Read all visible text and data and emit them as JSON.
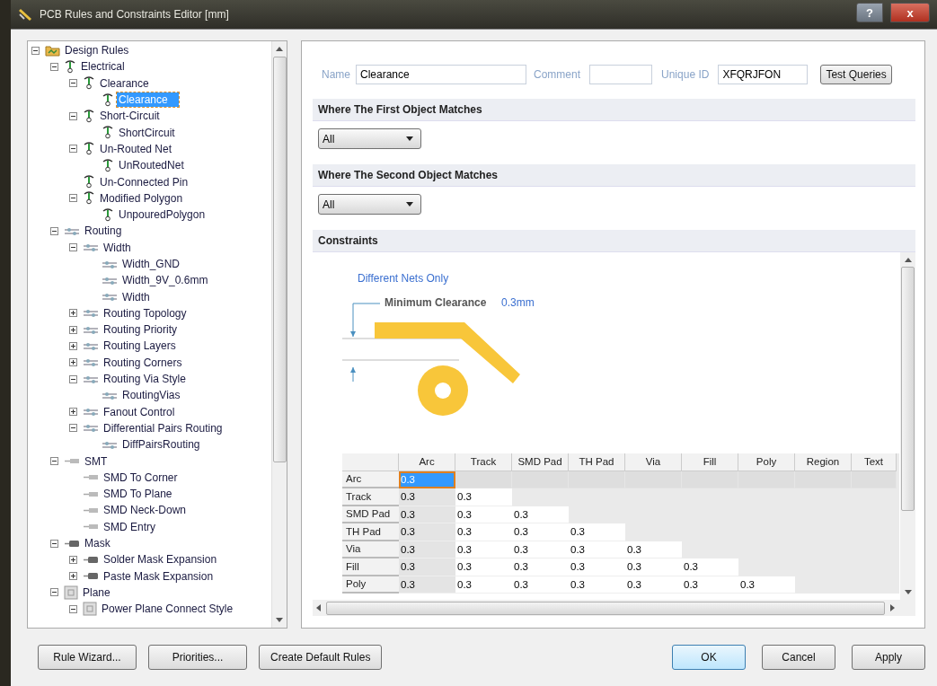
{
  "window": {
    "title": "PCB Rules and Constraints Editor [mm]",
    "help_button": "?",
    "close_button": "x"
  },
  "tree": [
    {
      "label": "Design Rules",
      "kind": "folder",
      "expanded": true,
      "selected": false,
      "children": [
        {
          "label": "Electrical",
          "kind": "electrical",
          "expanded": true,
          "selected": false,
          "children": [
            {
              "label": "Clearance",
              "kind": "electrical",
              "expanded": true,
              "selected": false,
              "children": [
                {
                  "label": "Clearance",
                  "kind": "electrical",
                  "selected": true
                }
              ]
            },
            {
              "label": "Short-Circuit",
              "kind": "electrical",
              "expanded": true,
              "selected": false,
              "children": [
                {
                  "label": "ShortCircuit",
                  "kind": "electrical",
                  "selected": false
                }
              ]
            },
            {
              "label": "Un-Routed Net",
              "kind": "electrical",
              "expanded": true,
              "selected": false,
              "children": [
                {
                  "label": "UnRoutedNet",
                  "kind": "electrical",
                  "selected": false
                }
              ]
            },
            {
              "label": "Un-Connected Pin",
              "kind": "electrical",
              "selected": false
            },
            {
              "label": "Modified Polygon",
              "kind": "electrical",
              "expanded": true,
              "selected": false,
              "children": [
                {
                  "label": "UnpouredPolygon",
                  "kind": "electrical",
                  "selected": false
                }
              ]
            }
          ]
        },
        {
          "label": "Routing",
          "kind": "routing",
          "expanded": true,
          "selected": false,
          "children": [
            {
              "label": "Width",
              "kind": "routing",
              "expanded": true,
              "selected": false,
              "children": [
                {
                  "label": "Width_GND",
                  "kind": "routing",
                  "selected": false
                },
                {
                  "label": "Width_9V_0.6mm",
                  "kind": "routing",
                  "selected": false
                },
                {
                  "label": "Width",
                  "kind": "routing",
                  "selected": false
                }
              ]
            },
            {
              "label": "Routing Topology",
              "kind": "routing",
              "expanded": false,
              "selected": false
            },
            {
              "label": "Routing Priority",
              "kind": "routing",
              "expanded": false,
              "selected": false
            },
            {
              "label": "Routing Layers",
              "kind": "routing",
              "expanded": false,
              "selected": false
            },
            {
              "label": "Routing Corners",
              "kind": "routing",
              "expanded": false,
              "selected": false
            },
            {
              "label": "Routing Via Style",
              "kind": "routing",
              "expanded": true,
              "selected": false,
              "children": [
                {
                  "label": "RoutingVias",
                  "kind": "routing",
                  "selected": false
                }
              ]
            },
            {
              "label": "Fanout Control",
              "kind": "routing",
              "expanded": false,
              "selected": false
            },
            {
              "label": "Differential Pairs Routing",
              "kind": "routing",
              "expanded": true,
              "selected": false,
              "children": [
                {
                  "label": "DiffPairsRouting",
                  "kind": "routing",
                  "selected": false
                }
              ]
            }
          ]
        },
        {
          "label": "SMT",
          "kind": "smt",
          "expanded": true,
          "selected": false,
          "children": [
            {
              "label": "SMD To Corner",
              "kind": "smt",
              "selected": false
            },
            {
              "label": "SMD To Plane",
              "kind": "smt",
              "selected": false
            },
            {
              "label": "SMD Neck-Down",
              "kind": "smt",
              "selected": false
            },
            {
              "label": "SMD Entry",
              "kind": "smt",
              "selected": false
            }
          ]
        },
        {
          "label": "Mask",
          "kind": "mask",
          "expanded": true,
          "selected": false,
          "children": [
            {
              "label": "Solder Mask Expansion",
              "kind": "mask",
              "expanded": false,
              "selected": false
            },
            {
              "label": "Paste Mask Expansion",
              "kind": "mask",
              "expanded": false,
              "selected": false
            }
          ]
        },
        {
          "label": "Plane",
          "kind": "plane",
          "expanded": true,
          "selected": false,
          "children": [
            {
              "label": "Power Plane Connect Style",
              "kind": "plane",
              "expanded": true,
              "selected": false
            }
          ]
        }
      ]
    }
  ],
  "rule": {
    "name_label": "Name",
    "name": "Clearance",
    "comment_label": "Comment",
    "unique_id_label": "Unique ID",
    "unique_id": "XFQRJFON",
    "test_button": "Test Queries"
  },
  "first_match": {
    "title": "Where The First Object Matches",
    "value": "All"
  },
  "second_match": {
    "title": "Where The Second Object Matches",
    "value": "All"
  },
  "constraints": {
    "title": "Constraints",
    "scope": "Different Nets Only",
    "min_label": "Minimum Clearance",
    "min_value": "0.3mm",
    "columns": [
      "Arc",
      "Track",
      "SMD Pad",
      "TH Pad",
      "Via",
      "Fill",
      "Poly",
      "Region",
      "Text"
    ],
    "rows": [
      {
        "label": "Arc",
        "cells": [
          {
            "value": "0.3",
            "selected": true
          }
        ]
      },
      {
        "label": "Track",
        "cells": [
          {
            "value": "0.3",
            "selected": false
          },
          {
            "value": "0.3",
            "selected": false
          }
        ]
      },
      {
        "label": "SMD Pad",
        "cells": [
          {
            "value": "0.3",
            "selected": false
          },
          {
            "value": "0.3",
            "selected": false
          },
          {
            "value": "0.3",
            "selected": false
          }
        ]
      },
      {
        "label": "TH Pad",
        "cells": [
          {
            "value": "0.3",
            "selected": false
          },
          {
            "value": "0.3",
            "selected": false
          },
          {
            "value": "0.3",
            "selected": false
          },
          {
            "value": "0.3",
            "selected": false
          }
        ]
      },
      {
        "label": "Via",
        "cells": [
          {
            "value": "0.3",
            "selected": false
          },
          {
            "value": "0.3",
            "selected": false
          },
          {
            "value": "0.3",
            "selected": false
          },
          {
            "value": "0.3",
            "selected": false
          },
          {
            "value": "0.3",
            "selected": false
          }
        ]
      },
      {
        "label": "Fill",
        "cells": [
          {
            "value": "0.3",
            "selected": false
          },
          {
            "value": "0.3",
            "selected": false
          },
          {
            "value": "0.3",
            "selected": false
          },
          {
            "value": "0.3",
            "selected": false
          },
          {
            "value": "0.3",
            "selected": false
          },
          {
            "value": "0.3",
            "selected": false
          }
        ]
      },
      {
        "label": "Poly",
        "cells": [
          {
            "value": "0.3",
            "selected": false
          },
          {
            "value": "0.3",
            "selected": false
          },
          {
            "value": "0.3",
            "selected": false
          },
          {
            "value": "0.3",
            "selected": false
          },
          {
            "value": "0.3",
            "selected": false
          },
          {
            "value": "0.3",
            "selected": false
          },
          {
            "value": "0.3",
            "selected": false
          }
        ]
      }
    ]
  },
  "buttons_left": [
    "Rule Wizard...",
    "Priorities...",
    "Create Default Rules"
  ],
  "buttons_right": [
    "OK",
    "Cancel",
    "Apply"
  ]
}
